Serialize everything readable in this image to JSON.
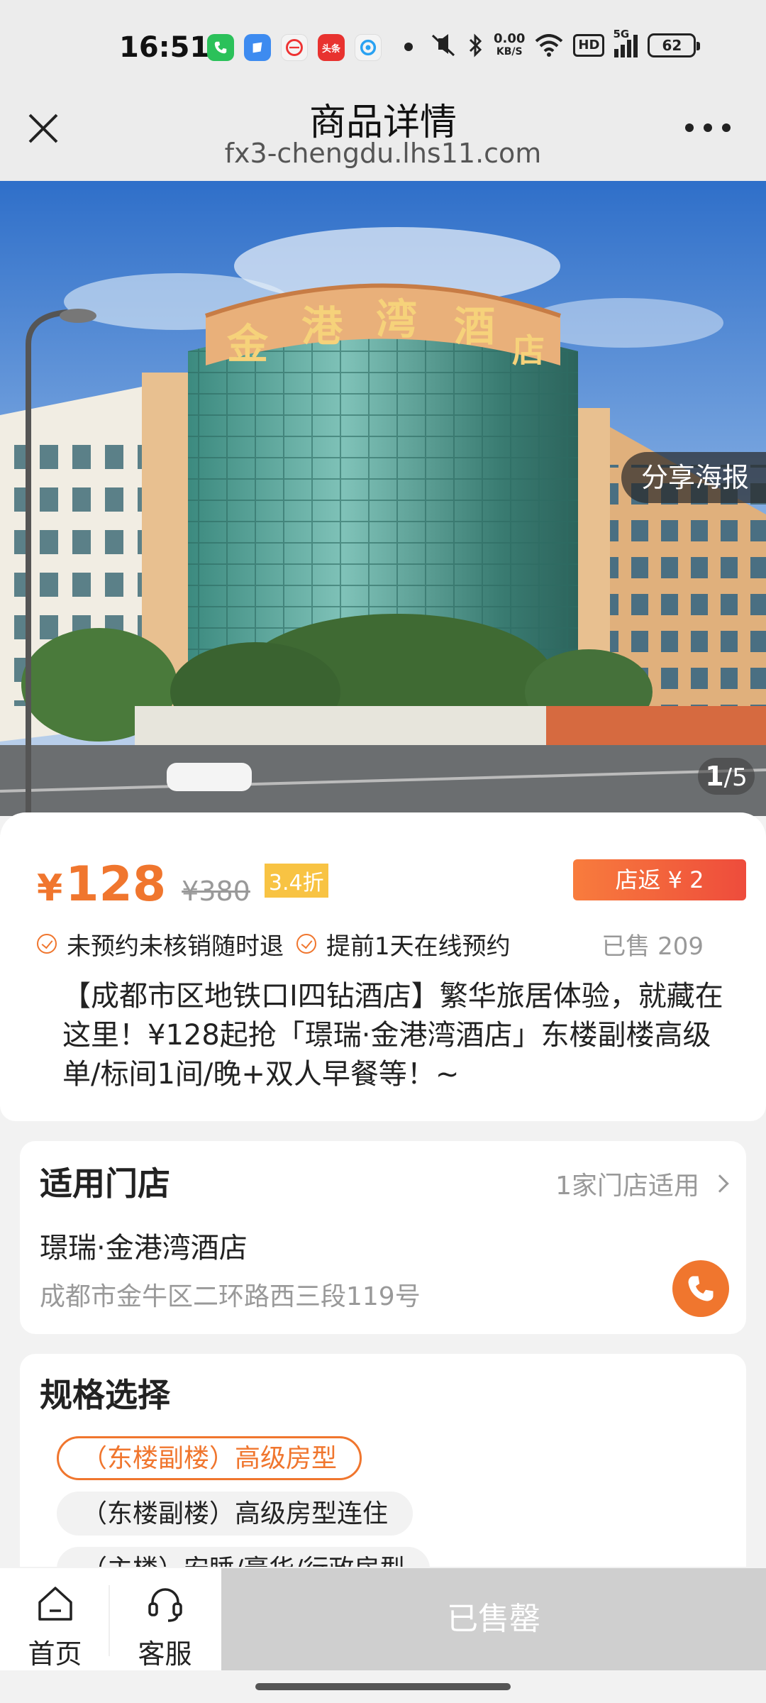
{
  "status_bar": {
    "time": "16:51",
    "net_speed_value": "0.00",
    "net_speed_unit": "KB/S",
    "hd": "HD",
    "signal": "5G",
    "battery": "62",
    "toutiao_label": "头条"
  },
  "header": {
    "title": "商品详情",
    "url": "fx3-chengdu.lhs11.com"
  },
  "hero": {
    "share_label": "分享海报",
    "counter_current": "1",
    "counter_total": "/5",
    "sign_chars": [
      "金",
      "港",
      "湾",
      "酒",
      "店"
    ]
  },
  "product": {
    "currency": "¥",
    "price": "128",
    "original_price": "¥380",
    "discount": "3.4折",
    "rebate": "店返 ¥ 2",
    "tags": [
      "未预约未核销随时退",
      "提前1天在线预约"
    ],
    "sold": "已售 209",
    "description": "【成都市区地铁口I四钻酒店】繁华旅居体验，就藏在这里！¥128起抢「璟瑞·金港湾酒店」东楼副楼高级单/标间1间/晚+双人早餐等！~"
  },
  "store": {
    "section_title": "适用门店",
    "count_label": "1家门店适用",
    "name": "璟瑞·金港湾酒店",
    "address": "成都市金牛区二环路西三段119号"
  },
  "spec": {
    "section_title": "规格选择",
    "options": [
      "（东楼副楼）高级房型",
      "（东楼副楼）高级房型连住",
      "（主楼）安睡/豪华/行政房型"
    ],
    "selected_index": 0
  },
  "bottom_bar": {
    "home_label": "首页",
    "service_label": "客服",
    "soldout_label": "已售罄"
  },
  "colors": {
    "accent": "#f0762e",
    "discount_badge": "#f8c343",
    "soldout": "#cfcfcf"
  },
  "icons": [
    "close-icon",
    "more-icon",
    "check-circle-icon",
    "chevron-right-icon",
    "phone-icon",
    "home-icon",
    "headset-icon"
  ]
}
